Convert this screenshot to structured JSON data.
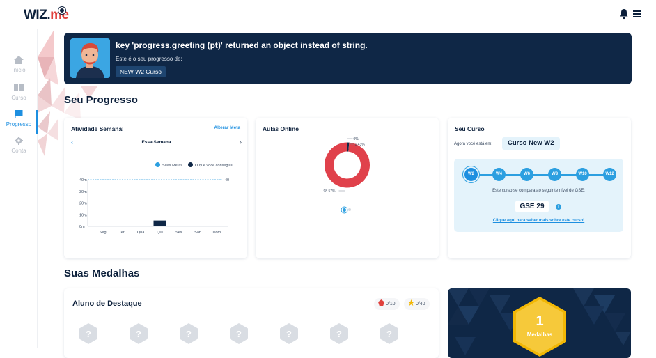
{
  "header": {
    "logo_wiz": "WIZ.",
    "logo_me": "me",
    "bell_icon": "bell-icon",
    "menu_icon": "menu-icon"
  },
  "sidebar": {
    "items": [
      {
        "label": "Início",
        "icon": "home-icon",
        "active": false
      },
      {
        "label": "Curso",
        "icon": "book-icon",
        "active": false
      },
      {
        "label": "Progresso",
        "icon": "flag-icon",
        "active": true
      },
      {
        "label": "Conta",
        "icon": "gear-icon",
        "active": false
      }
    ]
  },
  "banner": {
    "title": "key 'progress.greeting (pt)' returned an object instead of string.",
    "subtitle": "Este é o seu progresso de:",
    "course": "NEW W2 Curso"
  },
  "progress": {
    "section_title": "Seu Progresso",
    "weekly": {
      "title": "Atividade Semanal",
      "link": "Alterar Meta",
      "week_label": "Essa Semana",
      "legend_goals": "Suas Metas",
      "legend_achieved": "O que você conseguiu",
      "goal_value_label": "40",
      "colors": {
        "goal": "#2c9fe0",
        "achieved": "#0f2746"
      }
    },
    "online": {
      "title": "Aulas Online",
      "labels": [
        "0%",
        "1.43%",
        "98.57%"
      ]
    },
    "course": {
      "title": "Seu Curso",
      "current_label": "Agora você está em:",
      "current_course": "Curso New W2",
      "steps": [
        "W2",
        "W4",
        "W6",
        "W8",
        "W10",
        "W12"
      ],
      "active_step": 0,
      "compare_text": "Este curso se compara ao seguinte nível de GSE:",
      "gse": "GSE 29",
      "info_icon": "i",
      "more_link": "Clique aqui para saber mais sobre este curso!"
    }
  },
  "medals": {
    "section_title": "Suas Medalhas",
    "card_title": "Aluno de Destaque",
    "badge_red": "0/10",
    "badge_gold": "0/40",
    "placeholder_count": 7,
    "summary_count": "1",
    "summary_label": "Medalhas"
  },
  "chart_data": [
    {
      "type": "bar",
      "title": "Atividade Semanal",
      "categories": [
        "Seg",
        "Ter",
        "Qua",
        "Qui",
        "Sex",
        "Sáb",
        "Dom"
      ],
      "series": [
        {
          "name": "O que você conseguiu",
          "values": [
            0,
            0,
            0,
            5,
            0,
            0,
            0
          ]
        }
      ],
      "goal_line": 40,
      "yticks": [
        "0m",
        "10m",
        "20m",
        "30m",
        "40m"
      ],
      "ylim": [
        0,
        40
      ]
    },
    {
      "type": "pie",
      "title": "Aulas Online",
      "slices": [
        {
          "label": "0%",
          "value": 0
        },
        {
          "label": "1.43%",
          "value": 1.43
        },
        {
          "label": "98.57%",
          "value": 98.57
        }
      ]
    }
  ]
}
